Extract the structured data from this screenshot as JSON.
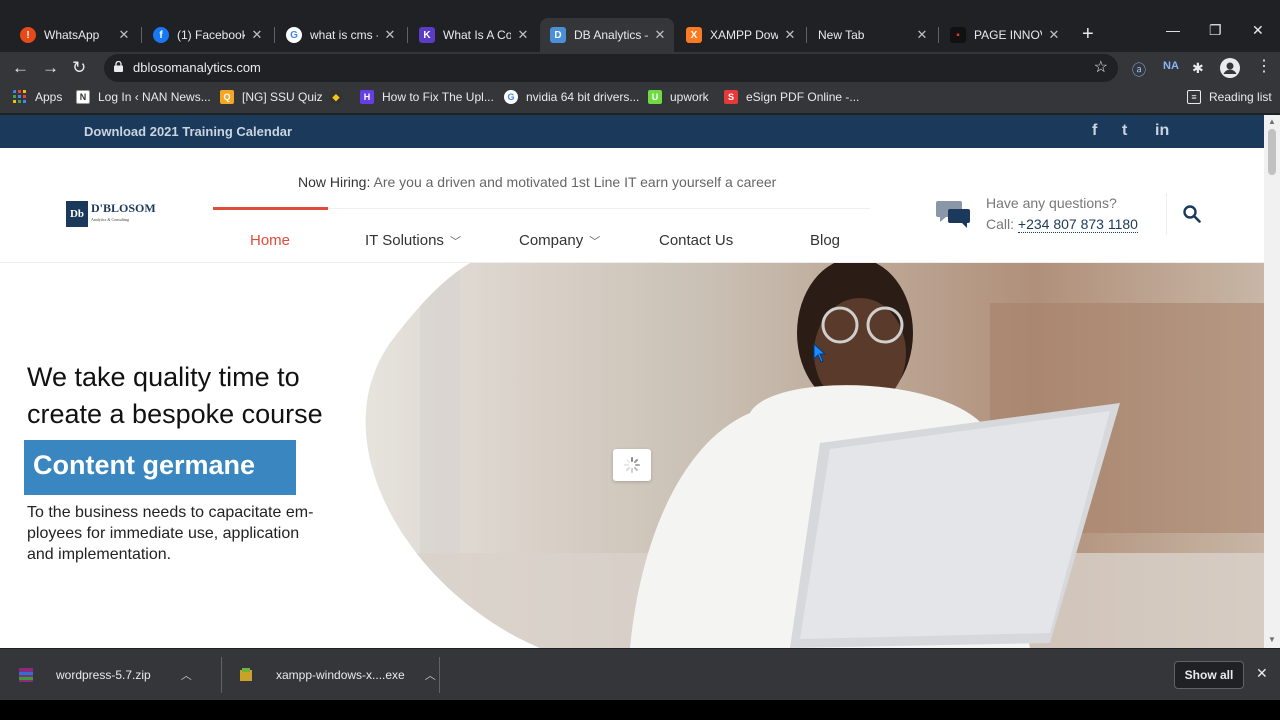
{
  "browser": {
    "tabs": [
      {
        "title": "WhatsApp",
        "icon": "whatsapp-icon",
        "color": "#e64a19",
        "glyph": "!"
      },
      {
        "title": "(1) Facebook",
        "icon": "facebook-icon",
        "color": "#1877f2",
        "glyph": "f"
      },
      {
        "title": "what is cms - G",
        "icon": "google-icon",
        "color": "#ffffff",
        "glyph": "G"
      },
      {
        "title": "What Is A Cont",
        "icon": "k-icon",
        "color": "#5b3cc4",
        "glyph": "K"
      },
      {
        "title": "DB Analytics –",
        "icon": "db-icon",
        "color": "#4a90d9",
        "glyph": "D"
      },
      {
        "title": "XAMPP Downl",
        "icon": "xampp-icon",
        "color": "#fb7a24",
        "glyph": "X"
      },
      {
        "title": "New Tab",
        "icon": "",
        "color": "",
        "glyph": ""
      },
      {
        "title": "PAGE INNOVA",
        "icon": "page-icon",
        "color": "#111111",
        "glyph": "▪"
      }
    ],
    "new_tab": "+",
    "minimize": "—",
    "maximize": "❐",
    "close": "✕",
    "url": "dblosomanalytics.com",
    "bookmarks": [
      {
        "label": "Apps",
        "icon": "apps-icon",
        "color": "#4285f4"
      },
      {
        "label": "Log In ‹ NAN News...",
        "icon": "nan-icon",
        "color": "#ffffff"
      },
      {
        "label": "[NG] SSU Quiz",
        "icon": "ssu-icon",
        "color": "#f5a623"
      },
      {
        "label": "",
        "icon": "bookmark-dark-icon",
        "color": "#333333"
      },
      {
        "label": "How to Fix The Upl...",
        "icon": "hostinger-icon",
        "color": "#673de6"
      },
      {
        "label": "nvidia 64 bit drivers...",
        "icon": "google-icon",
        "color": "#ffffff"
      },
      {
        "label": "upwork",
        "icon": "upwork-icon",
        "color": "#6fda44"
      },
      {
        "label": "eSign PDF Online -...",
        "icon": "esign-icon",
        "color": "#e8393a"
      }
    ],
    "reading_list": "Reading list"
  },
  "site": {
    "topbar": {
      "download": "Download 2021 Training Calendar",
      "social": [
        "f",
        "t",
        "in"
      ]
    },
    "hiring_label": "Now Hiring:",
    "hiring_text": " Are you a driven and motivated 1st Line IT earn yourself a career",
    "logo_text": "D'BLOSOM",
    "logo_sub": "Analytics & Consulting",
    "nav": [
      {
        "label": "Home",
        "active": true,
        "dropdown": false
      },
      {
        "label": "IT Solutions",
        "active": false,
        "dropdown": true
      },
      {
        "label": "Company",
        "active": false,
        "dropdown": true
      },
      {
        "label": "Contact Us",
        "active": false,
        "dropdown": false
      },
      {
        "label": "Blog",
        "active": false,
        "dropdown": false
      }
    ],
    "questions": "Have any questions?",
    "call_label": "Call: ",
    "phone": "+234 807 873 1180",
    "hero": {
      "headline_1": "We take quality time to",
      "headline_2": "create a bespoke course",
      "banner": "Content germane",
      "sub": "To the business needs to capacitate em-ployees for immediate use, application and implementation."
    },
    "accent": "#e04b3c",
    "brand": "#1b3a5b",
    "banner_color": "#3a86c0"
  },
  "downloads": {
    "items": [
      {
        "name": "wordpress-5.7.zip",
        "icon": "winrar-icon"
      },
      {
        "name": "xampp-windows-x....exe",
        "icon": "installer-icon"
      }
    ],
    "show_all": "Show all"
  }
}
